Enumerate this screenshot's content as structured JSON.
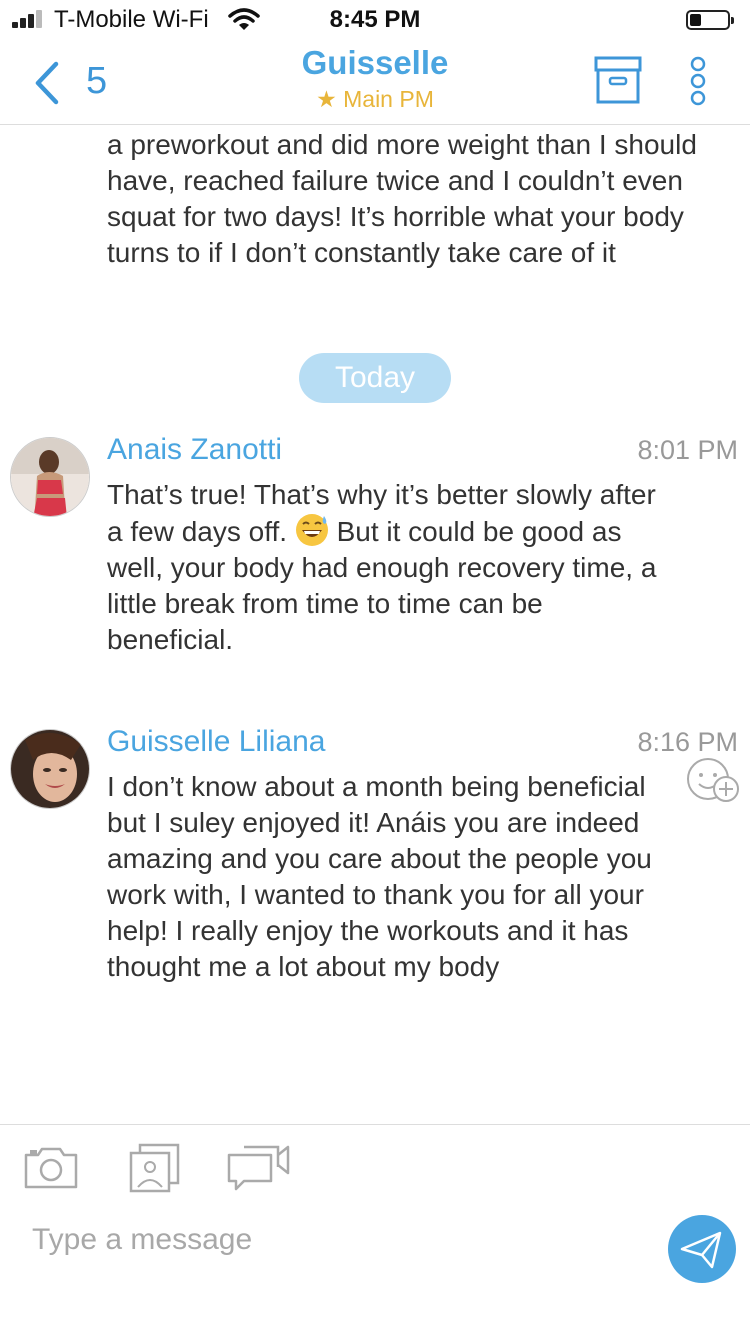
{
  "status": {
    "carrier": "T-Mobile Wi-Fi",
    "time": "8:45 PM",
    "signal_bars": 3,
    "battery_level": 0.3
  },
  "nav": {
    "back_count": "5",
    "title": "Guisselle",
    "subtitle": "★ Main PM",
    "icons": [
      "chevron-left-icon",
      "archive-icon",
      "more-vertical-icon"
    ]
  },
  "conversation": {
    "continued_text": "a preworkout and did more weight than I should have, reached failure twice and I couldn’t even squat for two days! It’s horrible what your body turns to if I don’t constantly take care of it",
    "date_separator": "Today",
    "messages": [
      {
        "sender": "Anais Zanotti",
        "time": "8:01 PM",
        "text_before_emoji": "That’s true! That’s why it’s better slowly after a few days off.",
        "emoji": "😅",
        "text_after_emoji": " But it could be good as well, your body had enough recovery time, a little break from time to time can be beneficial."
      },
      {
        "sender": "Guisselle Liliana",
        "time": "8:16 PM",
        "text": "I don’t know about a month being beneficial but I suley enjoyed it! Anáis you are indeed amazing and you care about the people you work with, I wanted to thank you for all your help! I really enjoy the workouts and it has thought me a lot about my body"
      }
    ]
  },
  "composer": {
    "placeholder": "Type a message",
    "tools": [
      "camera-icon",
      "gallery-icon",
      "video-chat-icon"
    ],
    "send_icon": "send-icon"
  },
  "colors": {
    "accent": "#4aa5e0",
    "star": "#e8b53a",
    "date_pill": "#b7ddf4"
  }
}
